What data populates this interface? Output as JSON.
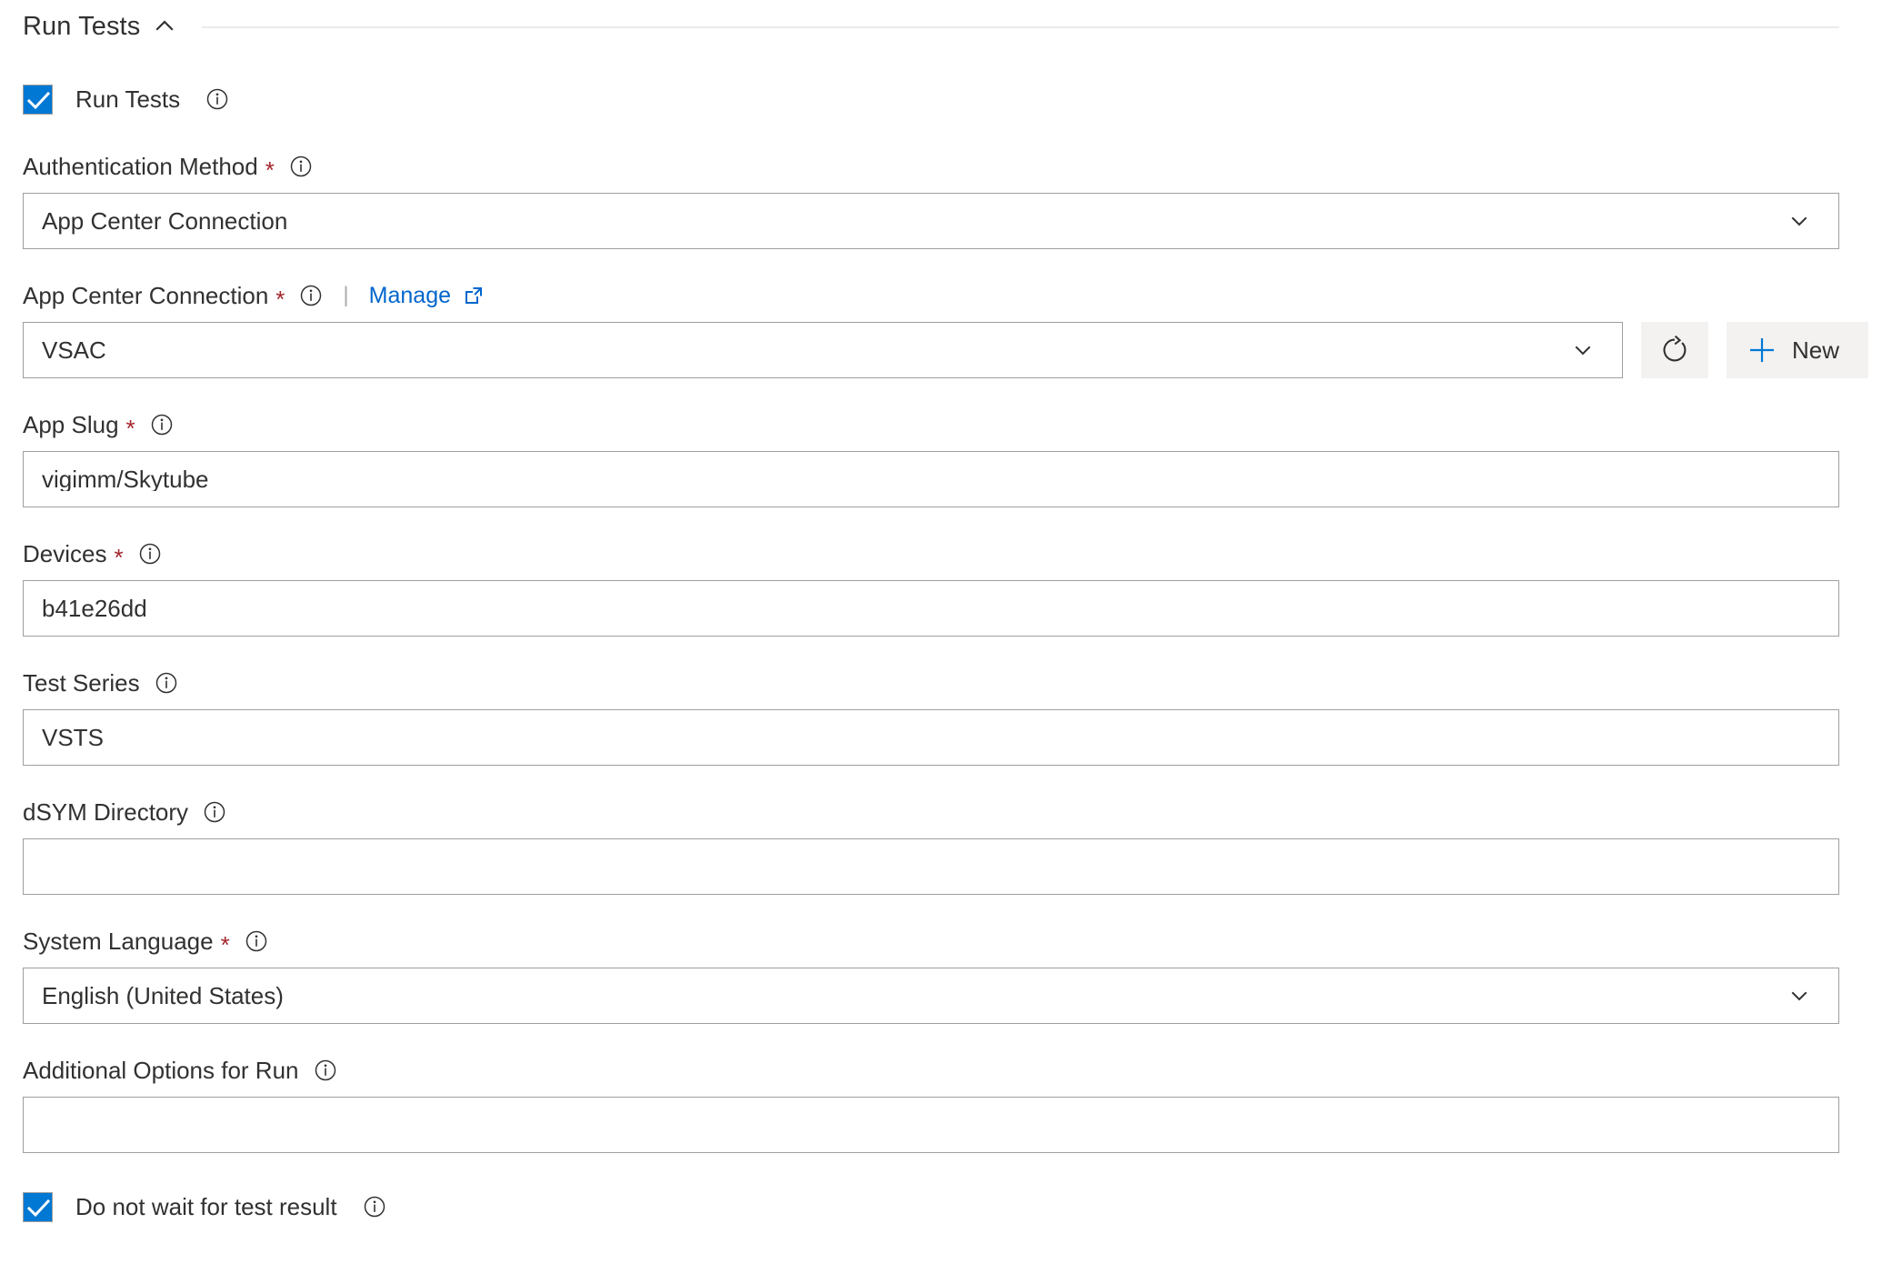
{
  "section": {
    "title": "Run Tests",
    "collapse_icon": "chevron-up-icon",
    "expanded": true
  },
  "colors": {
    "accent": "#0078d4",
    "link": "#0066cc",
    "required_star": "#a4262c",
    "border": "#a19f9d",
    "button_bg": "#f3f2f1",
    "text": "#323130",
    "rule": "#eceaea"
  },
  "run_tests_checkbox": {
    "label": "Run Tests",
    "checked": true,
    "info_icon": "info-icon"
  },
  "fields": {
    "authentication_method": {
      "label": "Authentication Method",
      "required": true,
      "required_marker": "*",
      "info_icon": "info-icon",
      "control": "dropdown",
      "value": "App Center Connection",
      "caret_icon": "chevron-down-icon"
    },
    "app_center_connection": {
      "label": "App Center Connection",
      "required": true,
      "required_marker": "*",
      "info_icon": "info-icon",
      "separator": "|",
      "manage_link": "Manage",
      "external_icon": "external-link-icon",
      "control": "dropdown",
      "value": "VSAC",
      "caret_icon": "chevron-down-icon",
      "refresh_button": {
        "icon": "refresh-icon",
        "label": ""
      },
      "new_button": {
        "icon": "plus-icon",
        "label": "New"
      }
    },
    "app_slug": {
      "label": "App Slug",
      "required": true,
      "required_marker": "*",
      "info_icon": "info-icon",
      "control": "text",
      "value": "vigimm/Skytube",
      "placeholder": ""
    },
    "devices": {
      "label": "Devices",
      "required": true,
      "required_marker": "*",
      "info_icon": "info-icon",
      "control": "text",
      "value": "b41e26dd",
      "placeholder": ""
    },
    "test_series": {
      "label": "Test Series",
      "required": false,
      "required_marker": "",
      "info_icon": "info-icon",
      "control": "text",
      "value": "VSTS",
      "placeholder": ""
    },
    "dsym_directory": {
      "label": "dSYM Directory",
      "required": false,
      "required_marker": "",
      "info_icon": "info-icon",
      "control": "text",
      "value": "",
      "placeholder": ""
    },
    "system_language": {
      "label": "System Language",
      "required": true,
      "required_marker": "*",
      "info_icon": "info-icon",
      "control": "dropdown",
      "value": "English (United States)",
      "caret_icon": "chevron-down-icon"
    },
    "additional_options": {
      "label": "Additional Options for Run",
      "required": false,
      "required_marker": "",
      "info_icon": "info-icon",
      "control": "text",
      "value": "",
      "placeholder": ""
    }
  },
  "do_not_wait_checkbox": {
    "label": "Do not wait for test result",
    "checked": true,
    "info_icon": "info-icon"
  }
}
